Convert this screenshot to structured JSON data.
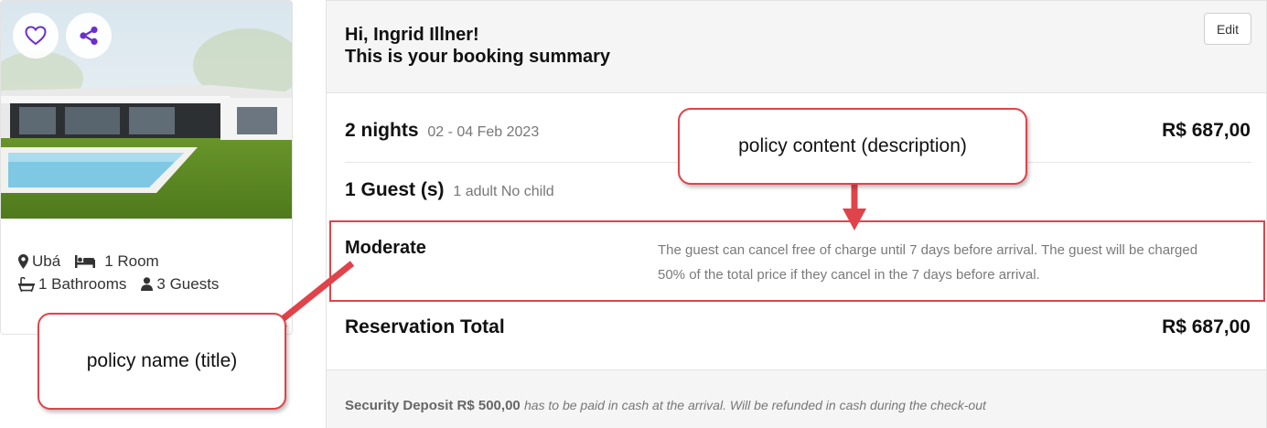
{
  "property": {
    "location": "Ubá",
    "rooms": "1 Room",
    "bathrooms": "1 Bathrooms",
    "guests": "3 Guests",
    "icons": [
      "heart-icon",
      "share-icon",
      "map-pin-icon",
      "bed-icon",
      "bathtub-icon",
      "user-icon"
    ]
  },
  "summary": {
    "greeting": "Hi, Ingrid Illner!",
    "subtitle": "This is your booking summary",
    "edit_label": "Edit",
    "nights_label": "2 nights",
    "dates": "02 - 04 Feb 2023",
    "nights_price": "R$ 687,00",
    "guests_label": "1 Guest (s)",
    "guests_detail": "1 adult No child",
    "policy_name": "Moderate",
    "policy_description": "The guest can cancel free of charge until 7 days before arrival. The guest will be charged 50% of the total price if they cancel in the 7 days before arrival.",
    "total_label": "Reservation Total",
    "total_price": "R$ 687,00",
    "deposit_label": "Security Deposit R$ 500,00",
    "deposit_note": "has to be paid in cash at the arrival. Will be refunded in cash during the check-out"
  },
  "annotations": {
    "description_callout": "policy content (description)",
    "title_callout": "policy name (title)",
    "accent_color": "#e0434a"
  }
}
